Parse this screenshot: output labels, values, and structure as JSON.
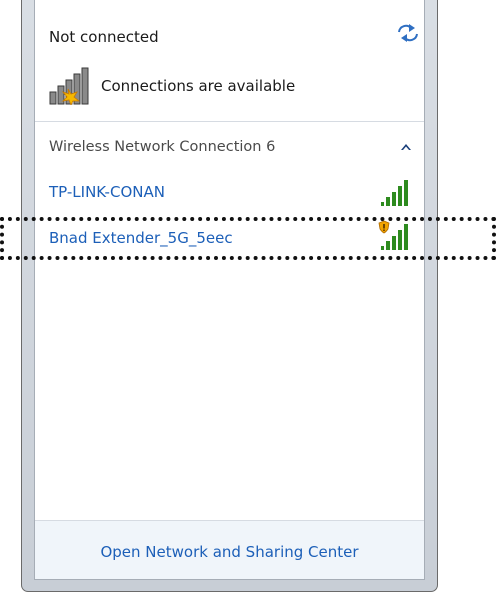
{
  "popup": {
    "status": "Not connected",
    "availability": "Connections are available",
    "section_title": "Wireless Network Connection 6",
    "networks": [
      {
        "name": "TP-LINK-CONAN",
        "signal_bars": 5,
        "secured": true
      },
      {
        "name": "Bnad Extender_5G_5eec",
        "signal_bars": 5,
        "secured": false,
        "warning_shield": true
      }
    ],
    "footer_link": "Open Network and Sharing Center"
  },
  "colors": {
    "link": "#1c5fb8",
    "signal_green": "#2e8b1f",
    "highlight_border": "#111111"
  },
  "icons": {
    "refresh": "refresh-icon",
    "availability": "signal-gray-starburst-icon",
    "collapse": "chevron-up-icon",
    "signal": "wifi-signal-icon",
    "warning": "shield-warning-icon"
  }
}
